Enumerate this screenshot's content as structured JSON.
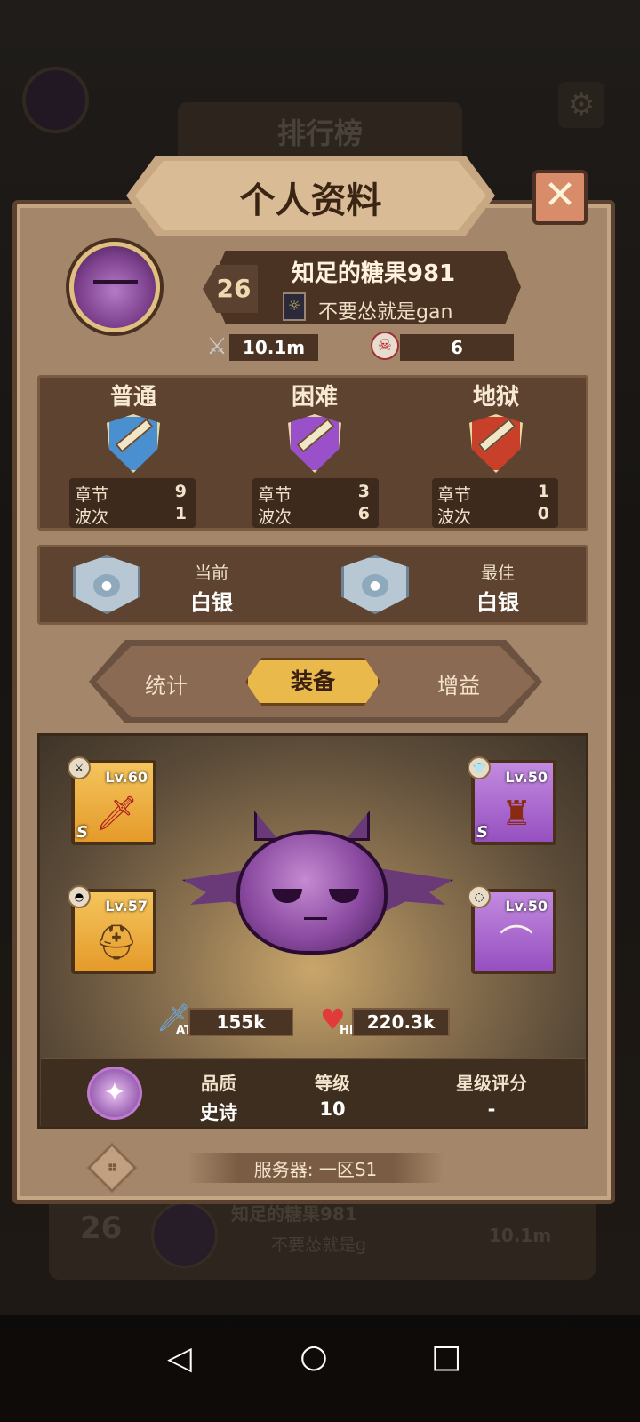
{
  "background": {
    "leaderboard_title": "排行榜",
    "row": {
      "rank": "26",
      "name": "知足的糖果981",
      "guild": "不要怂就是g",
      "power": "10.1m"
    }
  },
  "dialog": {
    "title": "个人资料",
    "close_icon": "✕"
  },
  "profile": {
    "level": "26",
    "name": "知足的糖果981",
    "guild": "不要怂就是gan",
    "power": "10.1m",
    "kills": "6"
  },
  "difficulties": [
    {
      "title": "普通",
      "chapter_label": "章节",
      "chapter": "9",
      "wave_label": "波次",
      "wave": "1",
      "color": "#4a8fd0"
    },
    {
      "title": "困难",
      "chapter_label": "章节",
      "chapter": "3",
      "wave_label": "波次",
      "wave": "6",
      "color": "#9a50c8"
    },
    {
      "title": "地狱",
      "chapter_label": "章节",
      "chapter": "1",
      "wave_label": "波次",
      "wave": "0",
      "color": "#c8402a"
    }
  ],
  "rank": {
    "current_label": "当前",
    "current_value": "白银",
    "best_label": "最佳",
    "best_value": "白银"
  },
  "tabs": {
    "stats": "统计",
    "equipment": "装备",
    "buffs": "增益",
    "active": "equipment"
  },
  "equipment": {
    "weapon": {
      "level": "Lv.60",
      "rarity": "S",
      "icon": "sword-icon"
    },
    "armor": {
      "level": "Lv.50",
      "rarity": "S",
      "icon": "armor-icon"
    },
    "helmet": {
      "level": "Lv.57",
      "icon": "helmet-icon"
    },
    "necklace": {
      "level": "Lv.50",
      "icon": "necklace-icon"
    }
  },
  "pet_stats": {
    "atk_label": "ATK",
    "atk_value": "155k",
    "hp_label": "HP",
    "hp_value": "220.3k"
  },
  "pet_info": {
    "quality_label": "品质",
    "quality_value": "史诗",
    "level_label": "等级",
    "level_value": "10",
    "star_label": "星级评分",
    "star_value": "-"
  },
  "server": "服务器: 一区S1",
  "navbar": {
    "back": "◁",
    "home": "○",
    "recent": "□"
  }
}
